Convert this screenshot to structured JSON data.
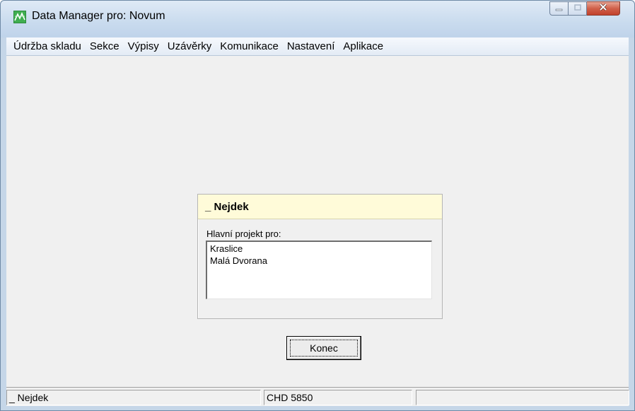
{
  "window": {
    "title": "Data Manager pro: Novum",
    "icon": "app-grid-icon"
  },
  "menu": {
    "items": [
      {
        "label": "Údržba skladu"
      },
      {
        "label": "Sekce"
      },
      {
        "label": "Výpisy"
      },
      {
        "label": "Uzávěrky"
      },
      {
        "label": "Komunikace"
      },
      {
        "label": "Nastavení"
      },
      {
        "label": "Aplikace"
      }
    ]
  },
  "panel": {
    "title": "_ Nejdek",
    "label": "Hlavní projekt pro:",
    "list": [
      "Kraslice",
      "Malá Dvorana"
    ]
  },
  "buttons": {
    "konec": "Konec"
  },
  "status": {
    "left": "_ Nejdek",
    "middle": "CHD 5850",
    "right": ""
  },
  "colors": {
    "panel_header_bg": "#fffbd9",
    "client_bg": "#f0f0f0",
    "close_button": "#c9503a"
  }
}
